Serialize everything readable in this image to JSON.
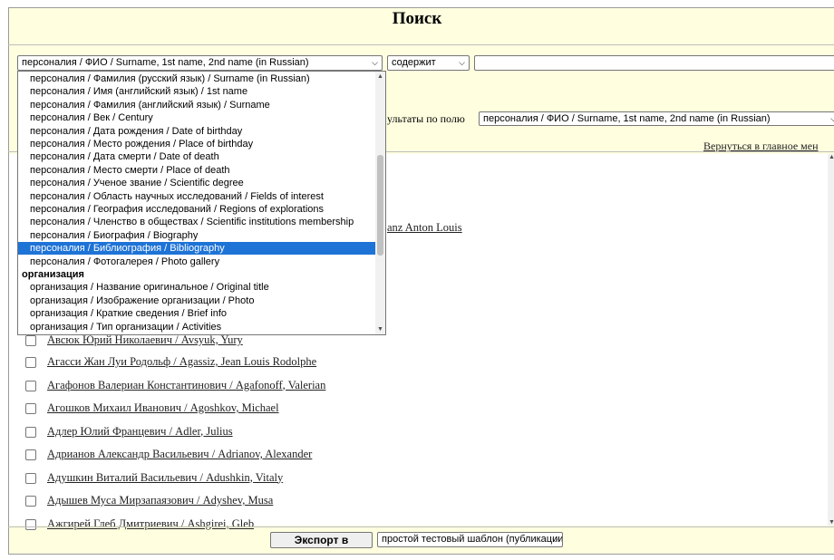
{
  "page": {
    "title": "Поиск",
    "field_select_value": "персоналия / ФИО / Surname, 1st name, 2nd name (in Russian)",
    "operator_select_value": "содержит",
    "search_input_value": "",
    "sort_label_text": "ультаты по полю",
    "sort_select_value": "персоналия / ФИО / Surname, 1st name, 2nd name (in Russian)",
    "back_link": "Вернуться в главное мен",
    "partial_link": "anz Anton Louis"
  },
  "dropdown": {
    "options": [
      {
        "label": "персоналия / Фамилия (русский язык) / Surname (in Russian)",
        "group": false,
        "selected": false
      },
      {
        "label": "персоналия / Имя (английский язык) / 1st name",
        "group": false,
        "selected": false
      },
      {
        "label": "персоналия / Фамилия (английский язык) / Surname",
        "group": false,
        "selected": false
      },
      {
        "label": "персоналия / Век / Century",
        "group": false,
        "selected": false
      },
      {
        "label": "персоналия / Дата рождения / Date of birthday",
        "group": false,
        "selected": false
      },
      {
        "label": "персоналия / Место рождения / Place of birthday",
        "group": false,
        "selected": false
      },
      {
        "label": "персоналия / Дата смерти / Date of death",
        "group": false,
        "selected": false
      },
      {
        "label": "персоналия / Место смерти / Place of death",
        "group": false,
        "selected": false
      },
      {
        "label": "персоналия / Ученое звание / Scientific degree",
        "group": false,
        "selected": false
      },
      {
        "label": "персоналия / Область научных исследований / Fields of interest",
        "group": false,
        "selected": false
      },
      {
        "label": "персоналия / География исследований / Regions of explorations",
        "group": false,
        "selected": false
      },
      {
        "label": "персоналия / Членство в обществах / Scientific institutions membership",
        "group": false,
        "selected": false
      },
      {
        "label": "персоналия / Биография / Biography",
        "group": false,
        "selected": false
      },
      {
        "label": "персоналия / Библиография / Bibliography",
        "group": false,
        "selected": true
      },
      {
        "label": "персоналия / Фотогалерея / Photo gallery",
        "group": false,
        "selected": false
      },
      {
        "label": "организация",
        "group": true,
        "selected": false
      },
      {
        "label": "организация / Название оригинальное / Original title",
        "group": false,
        "selected": false
      },
      {
        "label": "организация / Изображение организации / Photo",
        "group": false,
        "selected": false
      },
      {
        "label": "организация / Краткие сведения / Brief info",
        "group": false,
        "selected": false
      },
      {
        "label": "организация / Тип организации / Activities",
        "group": false,
        "selected": false
      }
    ]
  },
  "results": {
    "partial_row": "Авсюк Юрий Николаевич / Avsyuk, Yury",
    "rows": [
      "Агасси Жан Луи Родольф / Agassiz, Jean Louis Rodolphe",
      "Агафонов Валериан Константинович / Agafonoff, Valerian",
      "Агошков Михаил Иванович / Agoshkov, Michael",
      "Адлер Юлий Францевич / Adler, Julius",
      "Адрианов Александр Васильевич / Adrianov, Alexander",
      "Адушкин Виталий Васильевич / Adushkin, Vitaly",
      "Адышев Муса Мирзапаязович / Adyshev, Musa",
      "Ажгирей Глеб Дмитриевич / Ashgirei, Gleb"
    ]
  },
  "footer": {
    "export_button": "Экспорт в",
    "template_select_value": "простой тестовый шаблон (публикации)"
  }
}
